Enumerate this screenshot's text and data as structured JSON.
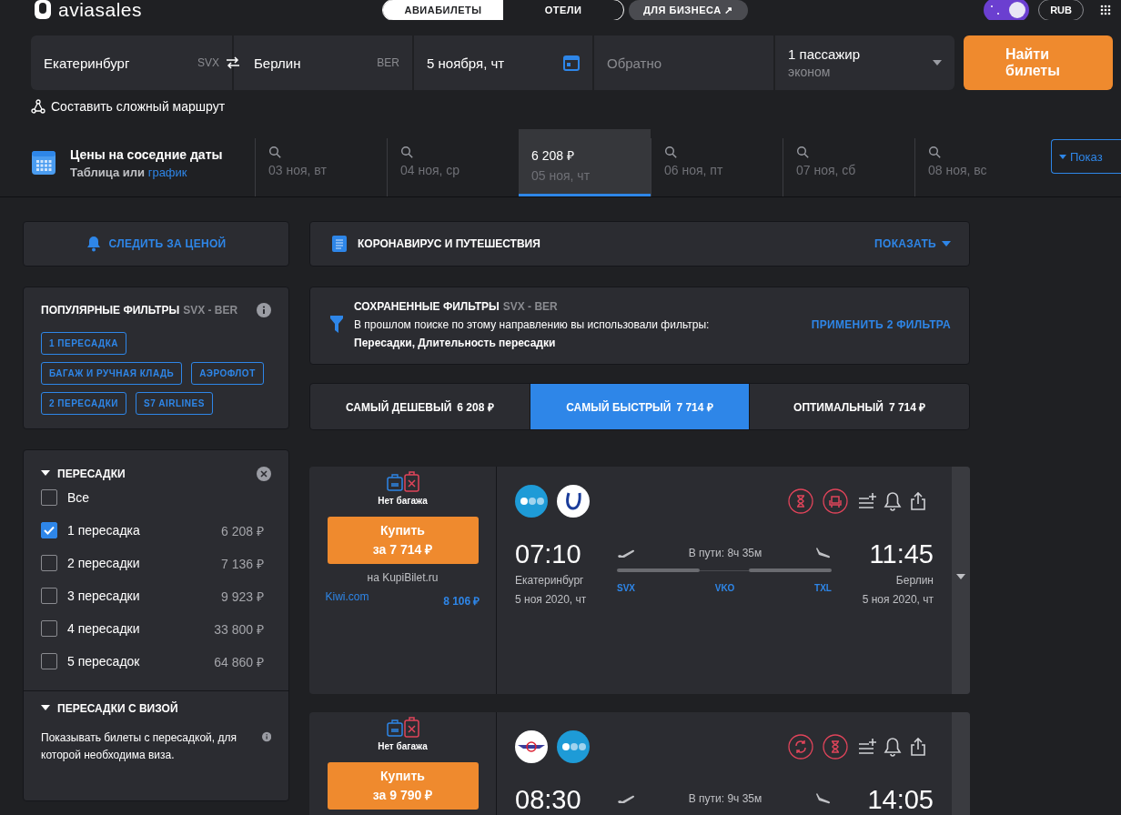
{
  "header": {
    "logo": "aviasales",
    "tabs": [
      {
        "label": "АВИАБИЛЕТЫ",
        "selected": true
      },
      {
        "label": "ОТЕЛИ",
        "selected": false
      }
    ],
    "business_link": "ДЛЯ БИЗНЕСА ↗",
    "currency": "RUB"
  },
  "search": {
    "origin": {
      "city": "Екатеринбург",
      "code": "SVX"
    },
    "destination": {
      "city": "Берлин",
      "code": "BER"
    },
    "date": "5 ноября, чт",
    "return_placeholder": "Обратно",
    "passengers": "1 пассажир",
    "cabin": "эконом",
    "submit": "Найти билеты",
    "complex_route": "Составить сложный маршрут"
  },
  "nearby_dates": {
    "title": "Цены на соседние даты",
    "subtitle": "Таблица или",
    "link": "график",
    "show_button": "Показ",
    "items": [
      {
        "date": "03 ноя, вт",
        "selected": false
      },
      {
        "date": "04 ноя, ср",
        "selected": false
      },
      {
        "price": "6 208 ₽",
        "date": "05 ноя, чт",
        "selected": true
      },
      {
        "date": "06 ноя, пт",
        "selected": false
      },
      {
        "date": "07 ноя, сб",
        "selected": false
      },
      {
        "date": "08 ноя, вс",
        "selected": false
      }
    ]
  },
  "price_watch": "СЛЕДИТЬ ЗА ЦЕНОЙ",
  "popular_filters": {
    "title": "ПОПУЛЯРНЫЕ ФИЛЬТРЫ",
    "route": "SVX - BER",
    "tags": [
      "1 ПЕРЕСАДКА",
      "БАГАЖ И РУЧНАЯ КЛАДЬ",
      "АЭРОФЛОТ",
      "2 ПЕРЕСАДКИ",
      "S7 AIRLINES"
    ]
  },
  "stops_filter": {
    "title": "ПЕРЕСАДКИ",
    "expanded": true,
    "options": [
      {
        "label": "Все",
        "checked": false
      },
      {
        "label": "1 пересадка",
        "price": "6 208 ₽",
        "checked": true
      },
      {
        "label": "2 пересадки",
        "price": "7 136 ₽",
        "checked": false
      },
      {
        "label": "3 пересадки",
        "price": "9 923 ₽",
        "checked": false
      },
      {
        "label": "4 пересадки",
        "price": "33 800 ₽",
        "checked": false
      },
      {
        "label": "5 пересадок",
        "price": "64 860 ₽",
        "checked": false
      }
    ]
  },
  "visa_filter": {
    "title": "ПЕРЕСАДКИ С ВИЗОЙ",
    "expanded": true,
    "text": "Показывать билеты с пересадкой, для которой необходима виза."
  },
  "covid_notice": {
    "title": "КОРОНАВИРУС И ПУТЕШЕСТВИЯ",
    "action": "ПОКАЗАТЬ"
  },
  "saved_filters": {
    "title": "СОХРАНЕННЫЕ ФИЛЬТРЫ",
    "route": "SVX - BER",
    "text": "В прошлом поиске по этому направлению вы использовали фильтры:",
    "filters": "Пересадки, Длительность пересадки",
    "action": "ПРИМЕНИТЬ 2 ФИЛЬТРА"
  },
  "sort_tabs": [
    {
      "label": "САМЫЙ ДЕШЕВЫЙ",
      "price": "6 208 ₽",
      "selected": false
    },
    {
      "label": "САМЫЙ БЫСТРЫЙ",
      "price": "7 714 ₽",
      "selected": true
    },
    {
      "label": "ОПТИМАЛЬНЫЙ",
      "price": "7 714 ₽",
      "selected": false
    }
  ],
  "tickets": [
    {
      "baggage": "Нет багажа",
      "buy": "Купить",
      "price": "за 7 714 ₽",
      "agency": "на KupiBilet.ru",
      "alt_offer": {
        "agency": "Kiwi.com",
        "price": "8 106 ₽"
      },
      "airlines": [
        {
          "kind": "dots"
        },
        {
          "kind": "swoosh"
        }
      ],
      "badges": [
        {
          "kind": "hourglass"
        },
        {
          "kind": "seat"
        }
      ],
      "departure": {
        "time": "07:10",
        "city": "Екатеринбург",
        "date": "5 ноя 2020, чт"
      },
      "duration": "В пути: 8ч 35м",
      "arrival": {
        "time": "11:45",
        "city": "Берлин",
        "date": "5 ноя 2020, чт"
      },
      "airports": [
        "SVX",
        "VKO",
        "TXL"
      ]
    },
    {
      "baggage": "Нет багажа",
      "buy": "Купить",
      "price": "за 9 790 ₽",
      "airlines": [
        {
          "kind": "wings"
        },
        {
          "kind": "dots"
        }
      ],
      "badges": [
        {
          "kind": "transfer"
        },
        {
          "kind": "hourglass"
        }
      ],
      "departure": {
        "time": "08:30"
      },
      "duration": "В пути: 9ч 35м",
      "arrival": {
        "time": "14:05"
      }
    }
  ]
}
